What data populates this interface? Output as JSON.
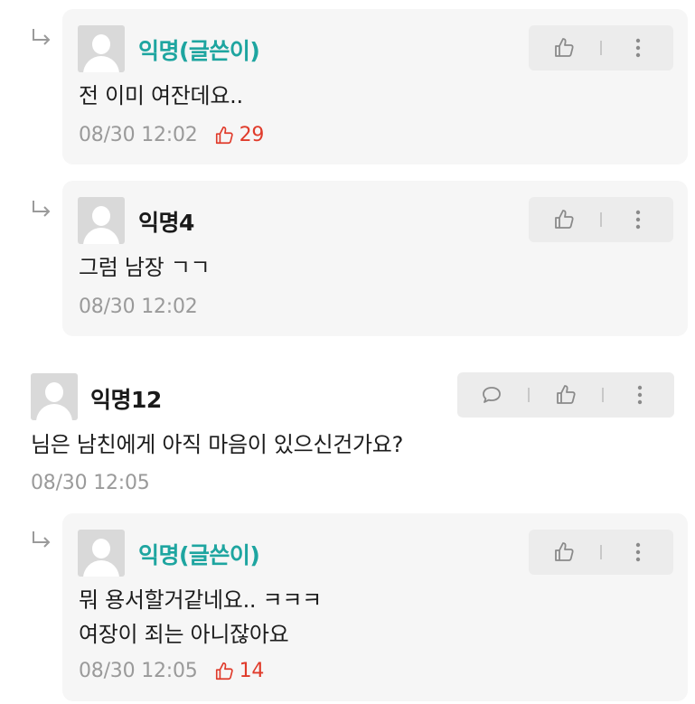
{
  "comments": [
    {
      "type": "reply",
      "author": "익명(글쓴이)",
      "is_op": true,
      "content": [
        "전 이미 여잔데요.."
      ],
      "time": "08/30 12:02",
      "likes": "29"
    },
    {
      "type": "reply",
      "author": "익명4",
      "is_op": false,
      "content": [
        "그럼 남장 ㄱㄱ"
      ],
      "time": "08/30 12:02",
      "likes": ""
    },
    {
      "type": "comment",
      "author": "익명12",
      "is_op": false,
      "content": [
        "님은 남친에게 아직 마음이 있으신건가요?"
      ],
      "time": "08/30 12:05",
      "likes": ""
    },
    {
      "type": "reply",
      "author": "익명(글쓴이)",
      "is_op": true,
      "content": [
        "뭐 용서할거같네요.. ㅋㅋㅋ",
        "여장이 죄는 아니잖아요"
      ],
      "time": "08/30 12:05",
      "likes": "14"
    }
  ],
  "colors": {
    "op_author": "#1ea5a0",
    "like": "#e03b2b",
    "meta": "#9a9a9a",
    "card_bg": "#f6f6f6"
  },
  "icons": {
    "reply_arrow": "reply-arrow-icon",
    "like": "thumbs-up-icon",
    "more": "more-vertical-icon",
    "comment": "speech-bubble-icon"
  }
}
